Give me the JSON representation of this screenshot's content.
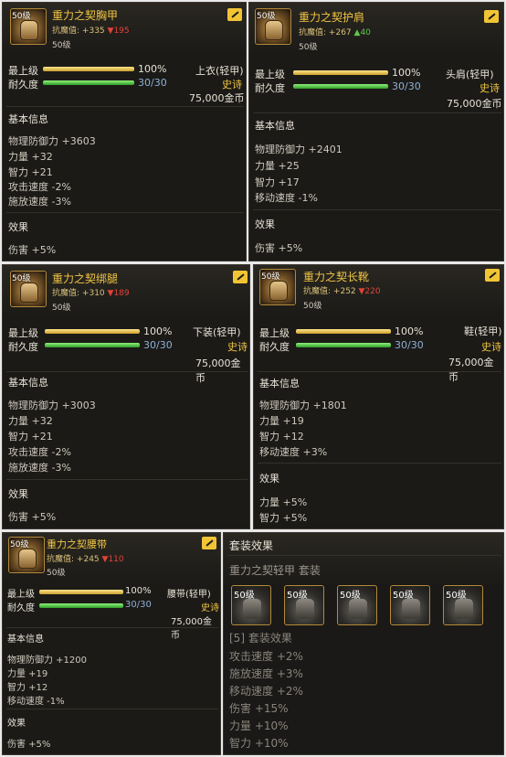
{
  "common": {
    "max_label": "最上级",
    "dur_label": "耐久度",
    "max_value": "100%",
    "dur_value": "30/30",
    "rarity": "史诗",
    "price": "75,000金币",
    "basic_title": "基本信息",
    "effect_title": "效果",
    "res_label": "抗魔值:",
    "level": "50级",
    "icon_level": "50级",
    "max_percent": 1.0,
    "dur_fraction": 1.0
  },
  "items": [
    {
      "name": "重力之契胸甲",
      "res_value": "+335",
      "res_delta": "▼195",
      "slot": "上衣(轻甲)",
      "stats": [
        "物理防御力 +3603",
        "力量 +32",
        "智力 +21",
        "攻击速度 -2%",
        "施放速度 -3%"
      ],
      "effects": [
        "伤害 +5%"
      ]
    },
    {
      "name": "重力之契护肩",
      "res_value": "+267",
      "res_delta": "▲40",
      "slot": "头肩(轻甲)",
      "stats": [
        "物理防御力 +2401",
        "力量 +25",
        "智力 +17",
        "移动速度 -1%"
      ],
      "effects": [
        "伤害 +5%"
      ]
    },
    {
      "name": "重力之契绑腿",
      "res_value": "+310",
      "res_delta": "▼189",
      "slot": "下装(轻甲)",
      "stats": [
        "物理防御力 +3003",
        "力量 +32",
        "智力 +21",
        "攻击速度 -2%",
        "施放速度 -3%"
      ],
      "effects": [
        "伤害 +5%"
      ]
    },
    {
      "name": "重力之契长靴",
      "res_value": "+252",
      "res_delta": "▼220",
      "slot": "鞋(轻甲)",
      "stats": [
        "物理防御力 +1801",
        "力量 +19",
        "智力 +12",
        "移动速度 +3%"
      ],
      "effects": [
        "力量 +5%",
        "智力 +5%"
      ]
    },
    {
      "name": "重力之契腰带",
      "res_value": "+245",
      "res_delta": "▼110",
      "slot": "腰带(轻甲)",
      "stats": [
        "物理防御力 +1200",
        "力量 +19",
        "智力 +12",
        "移动速度 -1%"
      ],
      "effects": [
        "伤害 +5%"
      ]
    }
  ],
  "set": {
    "title": "套装效果",
    "name": "重力之契轻甲 套装",
    "slots": [
      "50级",
      "50级",
      "50级",
      "50级",
      "50级"
    ],
    "bonus_title": "[5] 套装效果",
    "bonuses": [
      "攻击速度 +2%",
      "施放速度 +3%",
      "移动速度 +2%",
      "伤害 +15%",
      "力量 +10%",
      "智力 +10%"
    ]
  }
}
